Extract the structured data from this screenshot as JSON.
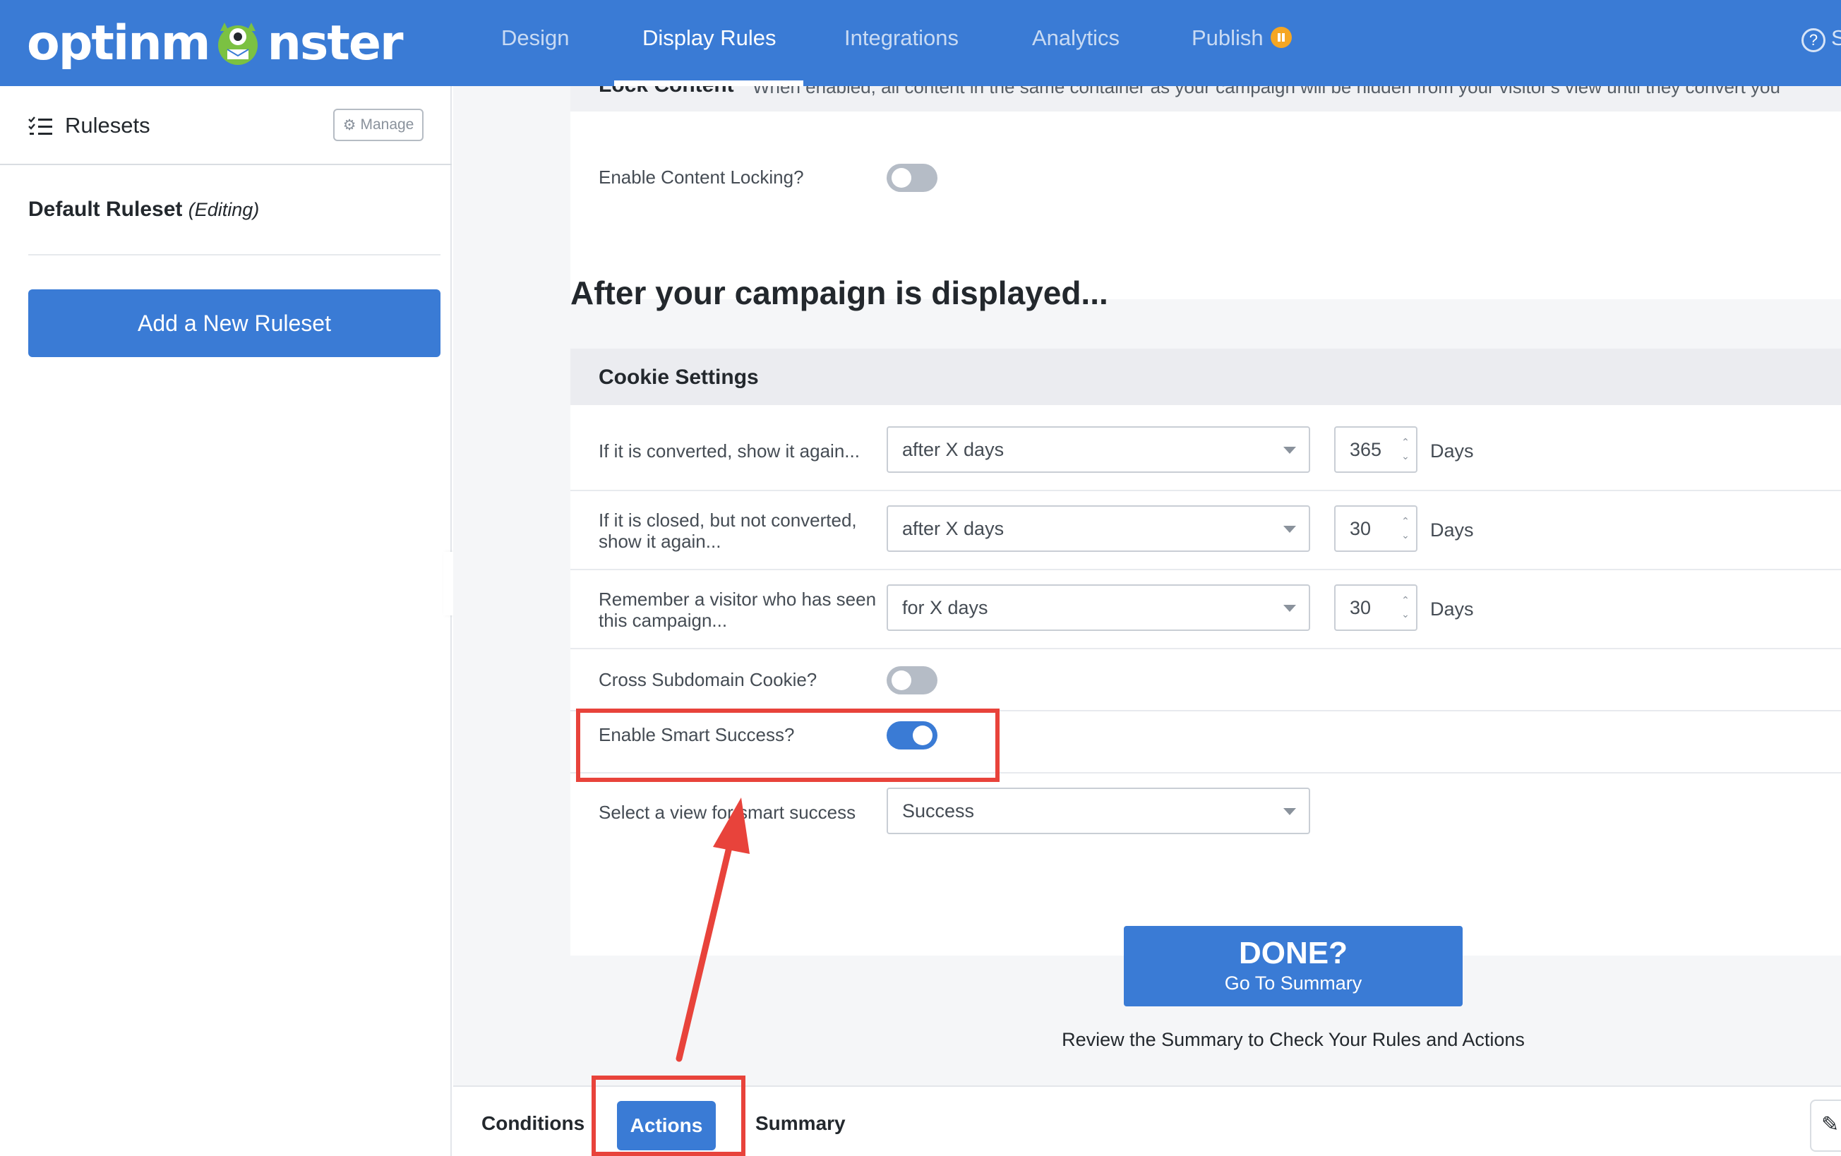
{
  "brand": {
    "logo_text_left": "optinm",
    "logo_text_right": "nster"
  },
  "nav": {
    "items": [
      {
        "label": "Design"
      },
      {
        "label": "Display Rules"
      },
      {
        "label": "Integrations"
      },
      {
        "label": "Analytics"
      },
      {
        "label": "Publish"
      }
    ],
    "help_label": "S"
  },
  "sidebar": {
    "title": "Rulesets",
    "manage_label": "Manage",
    "ruleset_name": "Default Ruleset",
    "ruleset_status": "(Editing)",
    "add_button": "Add a New Ruleset"
  },
  "lock_content": {
    "title": "Lock Content",
    "description": "When enabled, all content in the same container as your campaign will be hidden from your visitor's view until they convert you",
    "label": "Enable Content Locking?",
    "enabled": false
  },
  "after_section": {
    "title": "After your campaign is displayed...",
    "cookie_title": "Cookie Settings",
    "rows": [
      {
        "label": "If it is converted, show it again...",
        "select": "after X days",
        "number": "365",
        "unit": "Days"
      },
      {
        "label": "If it is closed, but not converted, show it again...",
        "select": "after X days",
        "number": "30",
        "unit": "Days"
      },
      {
        "label": "Remember a visitor who has seen this campaign...",
        "select": "for X days",
        "number": "30",
        "unit": "Days"
      }
    ],
    "cross_subdomain": {
      "label": "Cross Subdomain Cookie?",
      "enabled": false
    },
    "smart_success": {
      "label": "Enable Smart Success?",
      "enabled": true
    },
    "smart_view": {
      "label": "Select a view for smart success",
      "select": "Success"
    }
  },
  "done": {
    "big": "DONE?",
    "small": "Go To Summary",
    "review": "Review the Summary to Check Your Rules and Actions"
  },
  "bottom_tabs": {
    "conditions": "Conditions",
    "actions": "Actions",
    "summary": "Summary"
  },
  "colors": {
    "brand_blue": "#3a7bd5",
    "annotation_red": "#e8433b",
    "publish_badge": "#f5a623"
  }
}
